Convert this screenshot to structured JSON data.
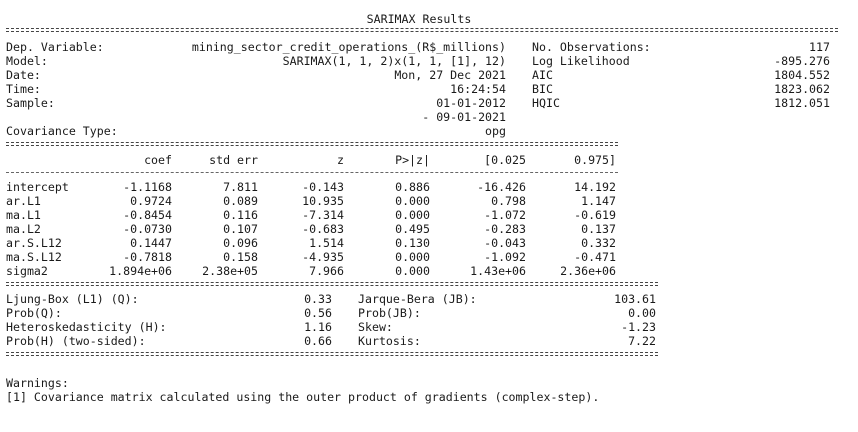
{
  "title": "SARIMAX Results",
  "info_left": [
    {
      "label": "Dep. Variable:",
      "value": "mining_sector_credit_operations_(R$_millions)"
    },
    {
      "label": "Model:",
      "value": "SARIMAX(1, 1, 2)x(1, 1, [1], 12)"
    },
    {
      "label": "Date:",
      "value": "Mon, 27 Dec 2021"
    },
    {
      "label": "Time:",
      "value": "16:24:54"
    },
    {
      "label": "Sample:",
      "value": "01-01-2012"
    },
    {
      "label": "",
      "value": "- 09-01-2021"
    },
    {
      "label": "Covariance Type:",
      "value": "opg"
    }
  ],
  "info_right": [
    {
      "label": "No. Observations:",
      "value": "117"
    },
    {
      "label": "Log Likelihood",
      "value": "-895.276"
    },
    {
      "label": "AIC",
      "value": "1804.552"
    },
    {
      "label": "BIC",
      "value": "1823.062"
    },
    {
      "label": "HQIC",
      "value": "1812.051"
    }
  ],
  "coef_headers": [
    "coef",
    "std err",
    "z",
    "P>|z|",
    "[0.025",
    "0.975]"
  ],
  "coef_rows": [
    {
      "name": "intercept",
      "values": [
        "-1.1168",
        "7.811",
        "-0.143",
        "0.886",
        "-16.426",
        "14.192"
      ]
    },
    {
      "name": "ar.L1",
      "values": [
        "0.9724",
        "0.089",
        "10.935",
        "0.000",
        "0.798",
        "1.147"
      ]
    },
    {
      "name": "ma.L1",
      "values": [
        "-0.8454",
        "0.116",
        "-7.314",
        "0.000",
        "-1.072",
        "-0.619"
      ]
    },
    {
      "name": "ma.L2",
      "values": [
        "-0.0730",
        "0.107",
        "-0.683",
        "0.495",
        "-0.283",
        "0.137"
      ]
    },
    {
      "name": "ar.S.L12",
      "values": [
        "0.1447",
        "0.096",
        "1.514",
        "0.130",
        "-0.043",
        "0.332"
      ]
    },
    {
      "name": "ma.S.L12",
      "values": [
        "-0.7818",
        "0.158",
        "-4.935",
        "0.000",
        "-1.092",
        "-0.471"
      ]
    },
    {
      "name": "sigma2",
      "values": [
        "1.894e+06",
        "2.38e+05",
        "7.966",
        "0.000",
        "1.43e+06",
        "2.36e+06"
      ]
    }
  ],
  "diagnostics": [
    {
      "l_label": "Ljung-Box (L1) (Q):",
      "l_value": "0.33",
      "r_label": "Jarque-Bera (JB):",
      "r_value": "103.61"
    },
    {
      "l_label": "Prob(Q):",
      "l_value": "0.56",
      "r_label": "Prob(JB):",
      "r_value": "0.00"
    },
    {
      "l_label": "Heteroskedasticity (H):",
      "l_value": "1.16",
      "r_label": "Skew:",
      "r_value": "-1.23"
    },
    {
      "l_label": "Prob(H) (two-sided):",
      "l_value": "0.66",
      "r_label": "Kurtosis:",
      "r_value": "7.22"
    }
  ],
  "warnings_title": "Warnings:",
  "warnings": [
    "[1] Covariance matrix calculated using the outer product of gradients (complex-step)."
  ]
}
